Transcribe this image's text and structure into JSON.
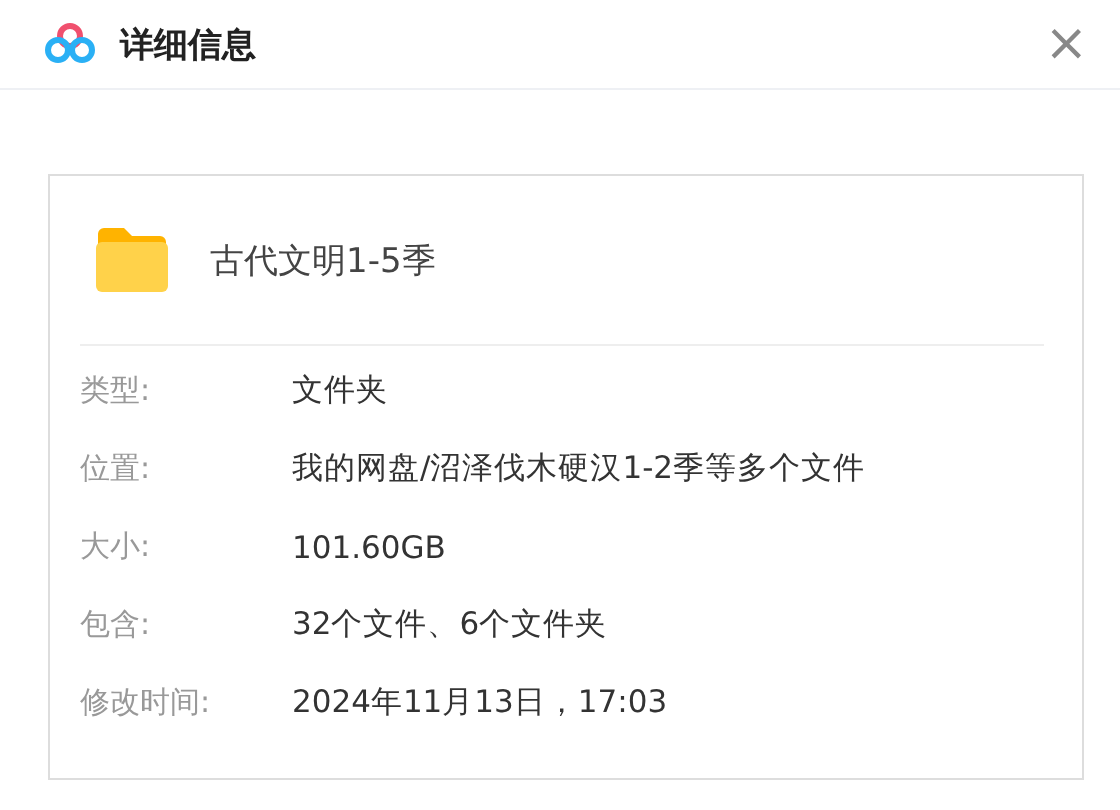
{
  "window": {
    "title": "详细信息",
    "close": "×"
  },
  "file": {
    "name": "古代文明1-5季"
  },
  "details": [
    {
      "label": "类型:",
      "value": "文件夹"
    },
    {
      "label": "位置:",
      "value": "我的网盘/沼泽伐木硬汉1-2季等多个文件"
    },
    {
      "label": "大小:",
      "value": "101.60GB"
    },
    {
      "label": "包含:",
      "value": "32个文件、6个文件夹"
    },
    {
      "label": "修改时间:",
      "value": "2024年11月13日，17:03"
    }
  ]
}
